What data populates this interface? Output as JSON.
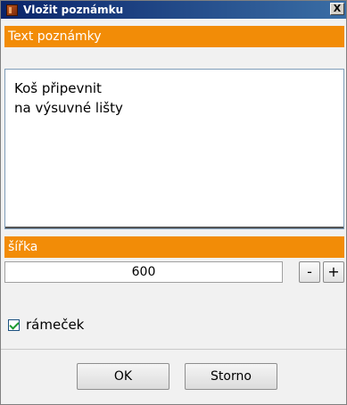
{
  "window": {
    "title": "Vložit poznámku",
    "close_label": "X"
  },
  "note": {
    "header": "Text poznámky",
    "value": "Koš připevnit\nna výsuvné lišty"
  },
  "width": {
    "header": "šířka",
    "value": "600",
    "decrement_label": "-",
    "increment_label": "+"
  },
  "frame": {
    "label": "rámeček",
    "checked": true
  },
  "buttons": {
    "ok_label": "OK",
    "cancel_label": "Storno"
  },
  "colors": {
    "accent": "#f28c07",
    "title_bar": "#0a246a"
  }
}
